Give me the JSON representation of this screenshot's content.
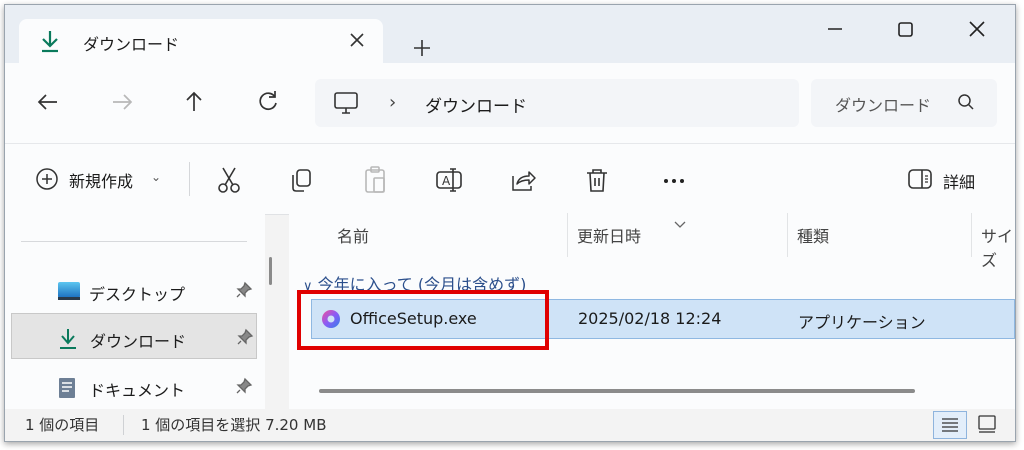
{
  "tab": {
    "title": "ダウンロード"
  },
  "address": {
    "crumb": "ダウンロード"
  },
  "search": {
    "placeholder": "ダウンロード"
  },
  "toolbar": {
    "new_label": "新規作成",
    "details_label": "詳細"
  },
  "sidebar": {
    "items": [
      {
        "label": "デスクトップ",
        "icon": "desktop-icon"
      },
      {
        "label": "ダウンロード",
        "icon": "download-icon"
      },
      {
        "label": "ドキュメント",
        "icon": "document-icon"
      }
    ]
  },
  "columns": {
    "name": "名前",
    "date": "更新日時",
    "type": "種類",
    "size": "サイズ"
  },
  "group": {
    "label": "今年に入って (今月は含めず)"
  },
  "file": {
    "name": "OfficeSetup.exe",
    "date": "2025/02/18 12:24",
    "type": "アプリケーション"
  },
  "status": {
    "count": "1 個の項目",
    "selected": "1 個の項目を選択  7.20 MB"
  },
  "colors": {
    "accent": "#0a7a5c",
    "highlight": "#e00000",
    "selection": "#cfe3f7"
  }
}
